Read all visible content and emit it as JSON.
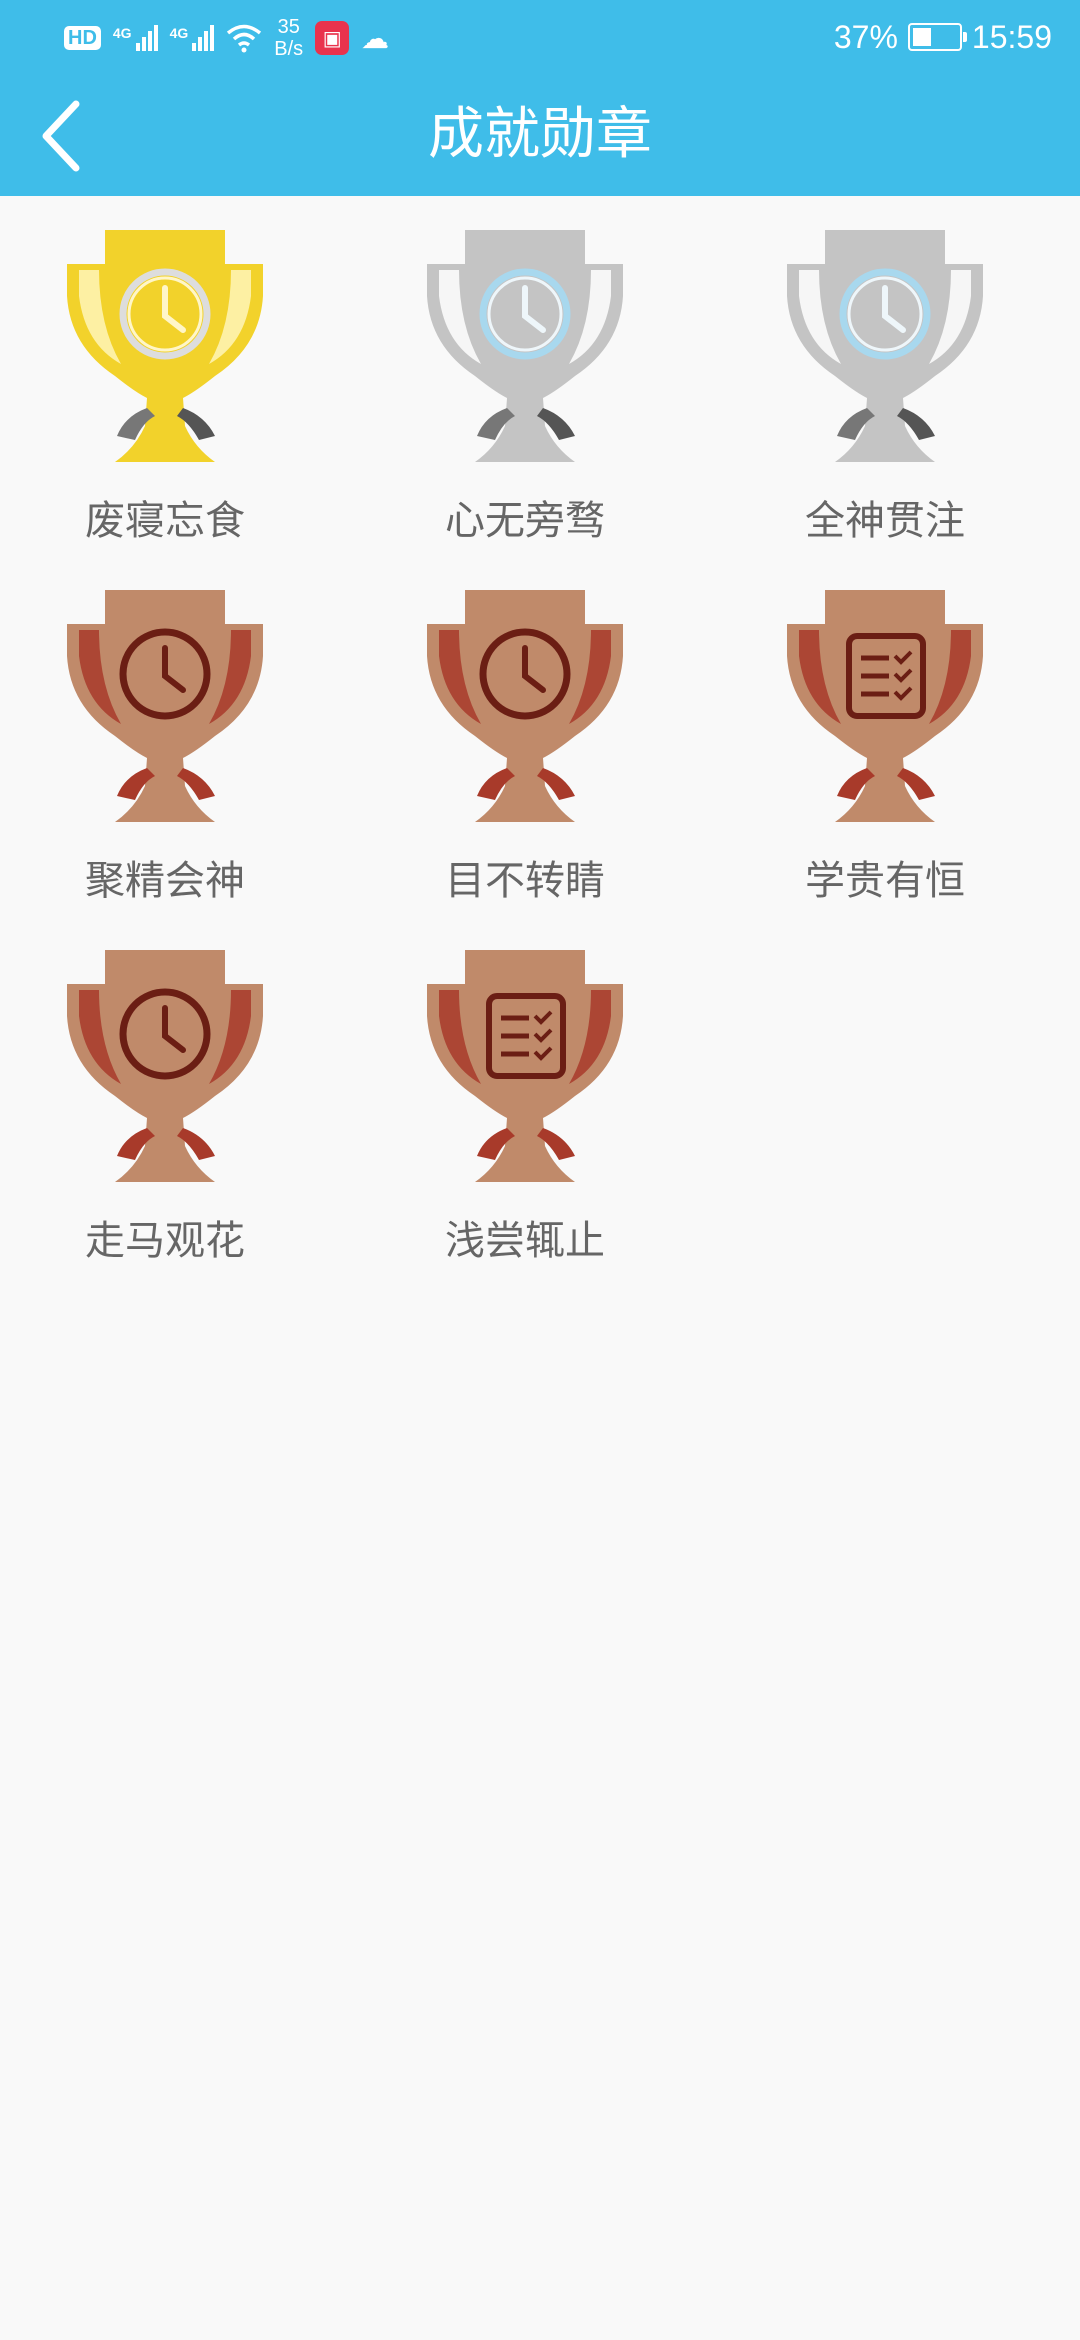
{
  "status_bar": {
    "hd": "HD",
    "sim1": "4G",
    "sim2": "4G",
    "net_speed_value": "35",
    "net_speed_unit": "B/s",
    "battery": "37%",
    "time": "15:59"
  },
  "header": {
    "title": "成就勋章"
  },
  "colors": {
    "accent": "#3fbde9",
    "gold": "#f2d22b",
    "silver": "#c4c4c4",
    "bronze": "#c08a6a"
  },
  "medals": [
    {
      "label": "废寝忘食",
      "tier": "gold",
      "icon": "clock-icon"
    },
    {
      "label": "心无旁骛",
      "tier": "silver",
      "icon": "clock-icon"
    },
    {
      "label": "全神贯注",
      "tier": "silver",
      "icon": "clock-icon"
    },
    {
      "label": "聚精会神",
      "tier": "bronze",
      "icon": "clock-icon"
    },
    {
      "label": "目不转睛",
      "tier": "bronze",
      "icon": "clock-icon"
    },
    {
      "label": "学贵有恒",
      "tier": "bronze",
      "icon": "checklist-icon"
    },
    {
      "label": "走马观花",
      "tier": "bronze",
      "icon": "clock-icon"
    },
    {
      "label": "浅尝辄止",
      "tier": "bronze",
      "icon": "checklist-icon"
    }
  ]
}
